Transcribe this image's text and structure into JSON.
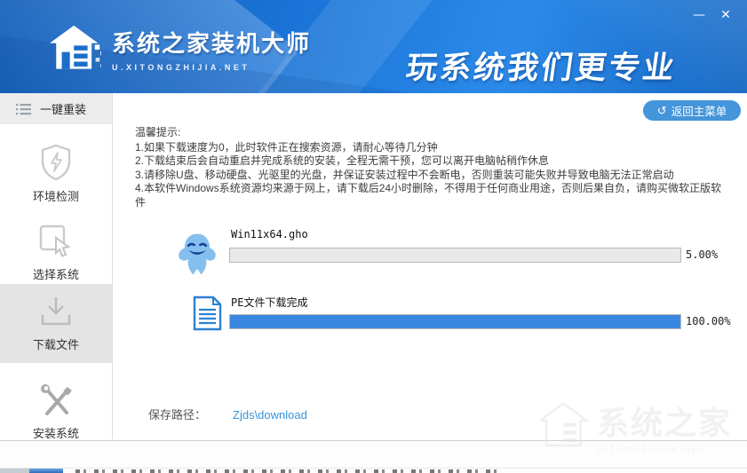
{
  "window": {
    "minimize_glyph": "—",
    "close_glyph": "✕"
  },
  "header": {
    "brand_title": "系统之家装机大师",
    "brand_url": "U.XITONGZHIJIA.NET",
    "slogan": "玩系统我们更专业"
  },
  "sidebar": {
    "header_label": "一键重装",
    "items": [
      {
        "label": "环境检测",
        "icon": "shield-lightning-icon",
        "active": false
      },
      {
        "label": "选择系统",
        "icon": "select-cursor-icon",
        "active": false
      },
      {
        "label": "下载文件",
        "icon": "download-icon",
        "active": true
      },
      {
        "label": "安装系统",
        "icon": "tools-icon",
        "active": false
      }
    ]
  },
  "main": {
    "return_button_label": "返回主菜单",
    "tips": {
      "title": "温馨提示:",
      "lines": [
        "1.如果下载速度为0，此时软件正在搜索资源，请耐心等待几分钟",
        "2.下载结束后会自动重启并完成系统的安装，全程无需干预，您可以离开电脑帖稍作休息",
        "3.请移除U盘、移动硬盘、光驱里的光盘，并保证安装过程中不会断电，否则重装可能失败并导致电脑无法正常启动",
        "4.本软件Windows系统资源均来源于网上，请下载后24小时删除，不得用于任何商业用途，否则后果自负，请购买微软正版软件"
      ]
    },
    "downloads": [
      {
        "icon": "ghost-file-icon",
        "label": "Win11x64.gho",
        "percent": 5,
        "percent_label": "5.00%",
        "fill": "#e9e9e9"
      },
      {
        "icon": "pe-document-icon",
        "label": "PE文件下载完成",
        "percent": 100,
        "percent_label": "100.00%",
        "fill": "#3a87e2"
      }
    ],
    "save_path": {
      "label": "保存路径：",
      "value": "Zjds\\download"
    }
  },
  "watermark": {
    "title": "系统之家",
    "subtitle": "XITONGZHIJIA.NET"
  },
  "colors": {
    "header_blue": "#1a73d6",
    "accent_button": "#4495da",
    "progress_fill_blue": "#3a87e2",
    "link_blue": "#3695dc",
    "active_item_bg": "#e4e4e4"
  }
}
